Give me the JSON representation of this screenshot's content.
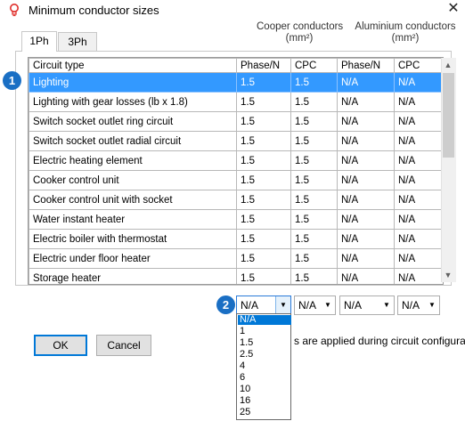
{
  "window": {
    "title": "Minimum conductor sizes",
    "close_glyph": "✕",
    "icon": "lightbulb-icon",
    "accent_color": "#e0302c"
  },
  "tabs": [
    {
      "label": "1Ph",
      "active": true
    },
    {
      "label": "3Ph",
      "active": false
    }
  ],
  "groups": {
    "copper": "Cooper conductors\n(mm²)",
    "copper_line1": "Cooper conductors",
    "copper_line2": "(mm²)",
    "aluminium_line1": "Aluminium conductors",
    "aluminium_line2": "(mm²)"
  },
  "table": {
    "headers": [
      "Circuit type",
      "Phase/N",
      "CPC",
      "Phase/N",
      "CPC"
    ],
    "selected_row": 0,
    "selection_color": "#3399ff",
    "rows": [
      [
        "Lighting",
        "1.5",
        "1.5",
        "N/A",
        "N/A"
      ],
      [
        "Lighting with gear losses (lb x 1.8)",
        "1.5",
        "1.5",
        "N/A",
        "N/A"
      ],
      [
        "Switch socket outlet ring circuit",
        "1.5",
        "1.5",
        "N/A",
        "N/A"
      ],
      [
        "Switch socket outlet radial circuit",
        "1.5",
        "1.5",
        "N/A",
        "N/A"
      ],
      [
        "Electric heating element",
        "1.5",
        "1.5",
        "N/A",
        "N/A"
      ],
      [
        "Cooker control unit",
        "1.5",
        "1.5",
        "N/A",
        "N/A"
      ],
      [
        "Cooker control unit with socket",
        "1.5",
        "1.5",
        "N/A",
        "N/A"
      ],
      [
        "Water instant heater",
        "1.5",
        "1.5",
        "N/A",
        "N/A"
      ],
      [
        "Electric boiler with thermostat",
        "1.5",
        "1.5",
        "N/A",
        "N/A"
      ],
      [
        "Electric under floor heater",
        "1.5",
        "1.5",
        "N/A",
        "N/A"
      ],
      [
        "Storage heater",
        "1.5",
        "1.5",
        "N/A",
        "N/A"
      ]
    ]
  },
  "callouts": {
    "one": "1",
    "two": "2",
    "color": "#1a6fc4"
  },
  "combos": [
    {
      "value": "N/A",
      "open": true
    },
    {
      "value": "N/A",
      "open": false
    },
    {
      "value": "N/A",
      "open": false
    },
    {
      "value": "N/A",
      "open": false
    }
  ],
  "dropdown_options": [
    "N/A",
    "1",
    "1.5",
    "2.5",
    "4",
    "6",
    "10",
    "16",
    "25"
  ],
  "dropdown_highlight": 0,
  "info_text": "s are applied during circuit configuration",
  "buttons": {
    "ok": "OK",
    "cancel": "Cancel"
  }
}
